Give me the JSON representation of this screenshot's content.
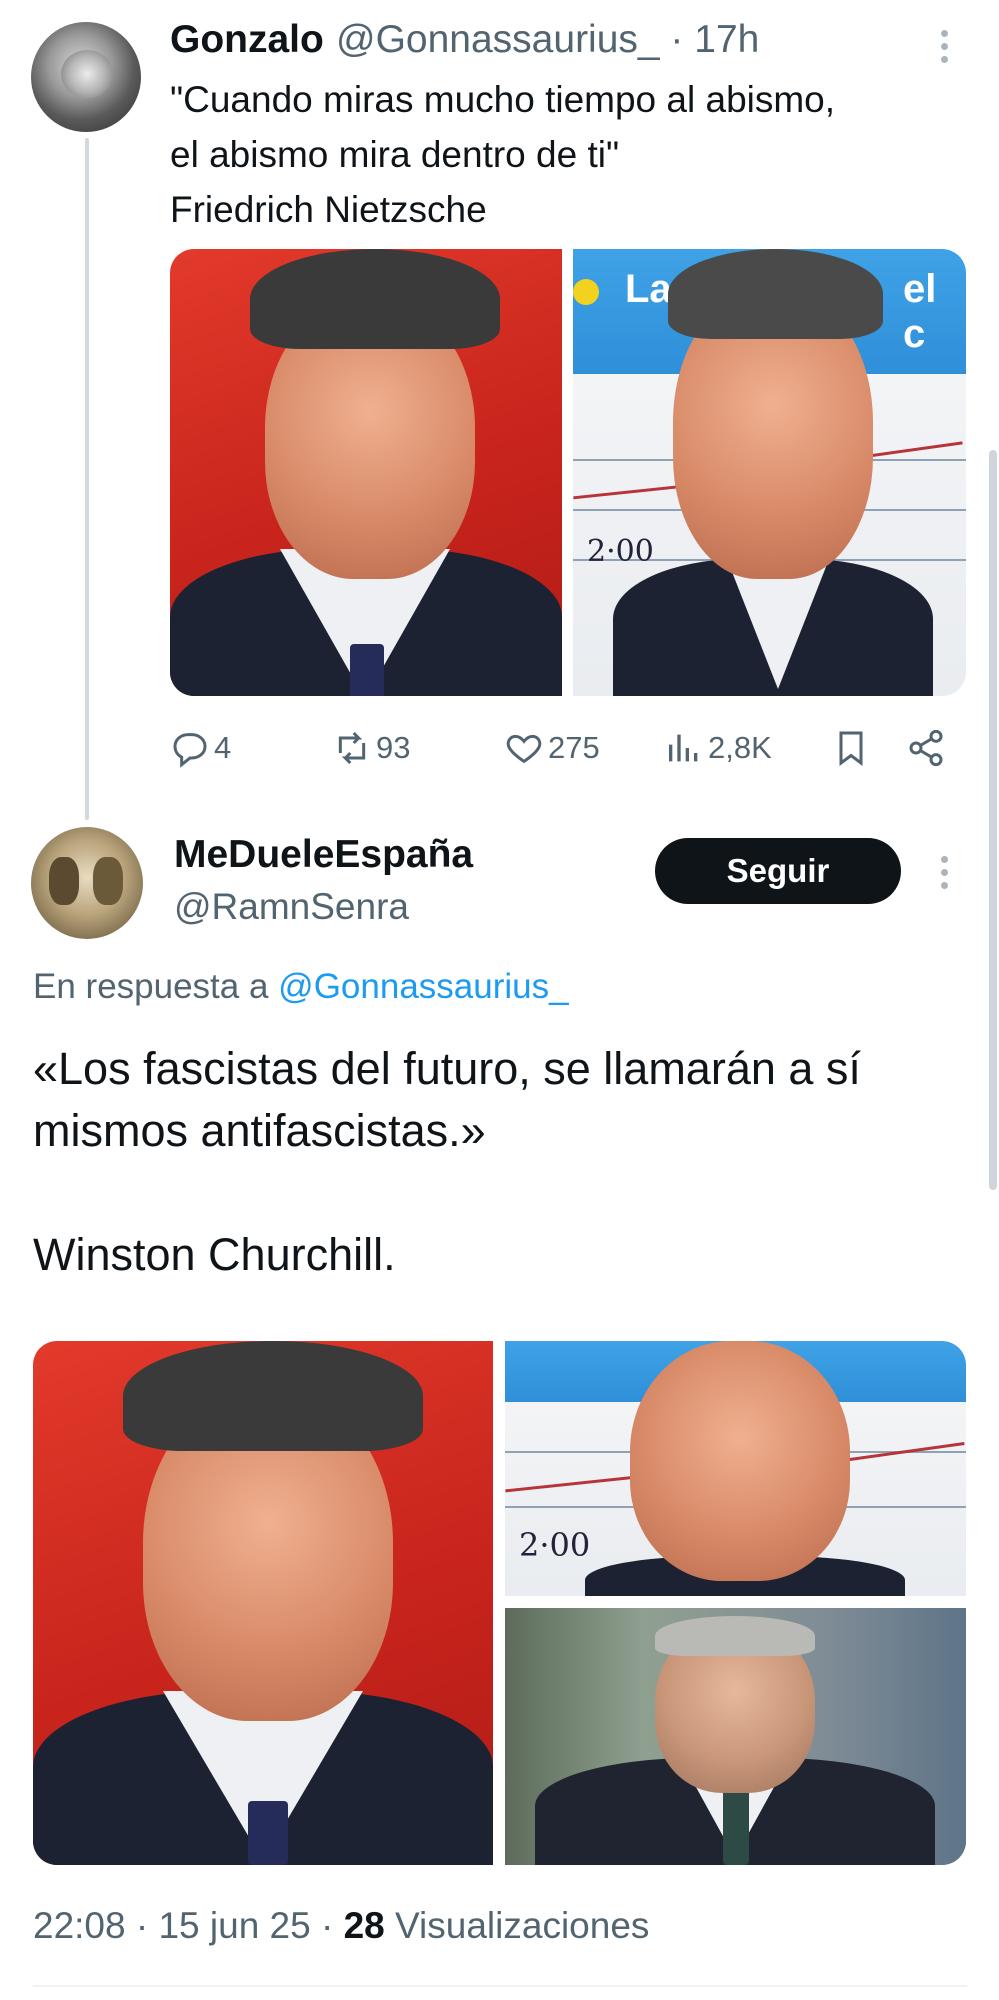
{
  "tweet1": {
    "author_name": "Gonzalo",
    "meta": "@Gonnassaurius_ · 17h",
    "text": "\"Cuando miras mucho tiempo al abismo,\nel abismo mira dentro de ti\"\nFriedrich Nietzsche",
    "image_overlay_text": "La",
    "image_overlay_text_right": "el c",
    "actions": {
      "replies": "4",
      "retweets": "93",
      "likes": "275",
      "views": "2,8K"
    }
  },
  "tweet2": {
    "author_name": "MeDueleEspaña",
    "handle": "@RamnSenra",
    "follow_label": "Seguir",
    "reply_prefix": "En respuesta a",
    "reply_handle": "@Gonnassaurius_",
    "text": "«Los fascistas del futuro, se llamarán a sí mismos antifascistas.»\n\nWinston Churchill.",
    "timestamp": "22:08 · 15 jun 25 ·",
    "views_count": "28",
    "views_label": "Visualizaciones"
  },
  "colors": {
    "text_primary": "#0f1419",
    "text_secondary": "#536471",
    "link": "#1d9bf0",
    "button_bg": "#0f1419"
  },
  "icons": [
    "more-icon",
    "reply-icon",
    "retweet-icon",
    "like-icon",
    "views-icon",
    "bookmark-icon",
    "share-icon"
  ]
}
